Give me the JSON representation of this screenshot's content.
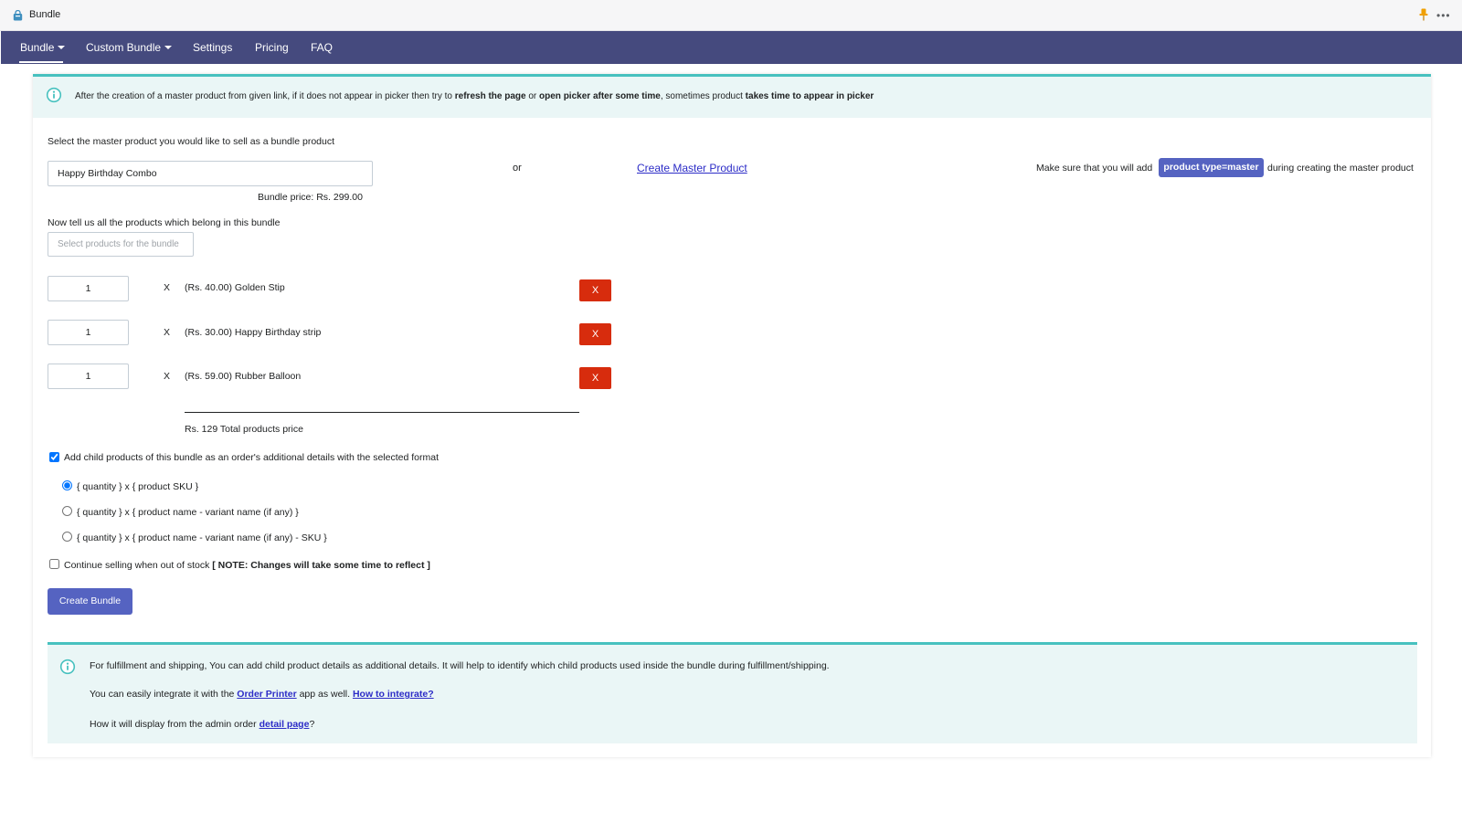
{
  "window": {
    "title": "Bundle",
    "app_icon": "shopping-bag-icon",
    "pin_icon": "pin-icon",
    "more_label": "•••"
  },
  "nav": {
    "items": [
      {
        "label": "Bundle",
        "has_dropdown": true,
        "active": true
      },
      {
        "label": "Custom Bundle",
        "has_dropdown": true,
        "active": false
      },
      {
        "label": "Settings",
        "has_dropdown": false,
        "active": false
      },
      {
        "label": "Pricing",
        "has_dropdown": false,
        "active": false
      },
      {
        "label": "FAQ",
        "has_dropdown": false,
        "active": false
      }
    ]
  },
  "info_banner": {
    "icon": "info-icon",
    "text_1": "After the creation of a master product from given link, if it does not appear in picker then try to ",
    "bold_1": "refresh the page",
    "text_2": " or ",
    "bold_2": "open picker after some time",
    "text_3": ", sometimes product ",
    "bold_3": "takes time to appear in picker"
  },
  "master": {
    "label": "Select the master product you would like to sell as a bundle product",
    "value": "Happy Birthday Combo",
    "or_label": "or",
    "create_link": "Create Master Product",
    "note_before": "Make sure that you will add",
    "badge": "product type=master",
    "note_after": "during creating the master product",
    "bundle_price": "Bundle price: Rs. 299.00"
  },
  "products": {
    "label": "Now tell us all the products which belong in this bundle",
    "placeholder": "Select products for the bundle",
    "times_symbol": "X",
    "remove_label": "X",
    "items": [
      {
        "qty": "1",
        "name": "(Rs. 40.00) Golden Stip"
      },
      {
        "qty": "1",
        "name": "(Rs. 30.00) Happy Birthday strip"
      },
      {
        "qty": "1",
        "name": "(Rs. 59.00) Rubber Balloon"
      }
    ],
    "total": "Rs. 129 Total products price"
  },
  "options": {
    "add_child_label": "Add child products of this bundle as an order's additional details with the selected format",
    "add_child_checked": true,
    "formats": [
      {
        "label": "{ quantity } x { product SKU }",
        "selected": true
      },
      {
        "label": "{ quantity } x { product name - variant name (if any) }",
        "selected": false
      },
      {
        "label": "{ quantity } x { product name - variant name (if any) - SKU }",
        "selected": false
      }
    ],
    "continue_selling_label": "Continue selling when out of stock ",
    "continue_selling_note": "[ NOTE: Changes will take some time to reflect ]",
    "continue_selling_checked": false
  },
  "create_button": "Create Bundle",
  "fulfillment_banner": {
    "icon": "info-icon",
    "line_1": "For fulfillment and shipping, You can add child product details as additional details. It will help to identify which child products used inside the bundle during fulfillment/shipping.",
    "line_2_before": "You can easily integrate it with the ",
    "line_2_link_1": "Order Printer",
    "line_2_middle": " app as well. ",
    "line_2_link_2": "How to integrate?",
    "line_3_before": "How it will display from the admin order ",
    "line_3_link": "detail page",
    "line_3_after": "?"
  },
  "colors": {
    "nav_bg": "#454a7e",
    "primary": "#5563c1",
    "danger": "#d72c0d",
    "info_bg": "#eaf6f6",
    "info_border": "#47c1bf",
    "link": "#2c2cc7"
  }
}
